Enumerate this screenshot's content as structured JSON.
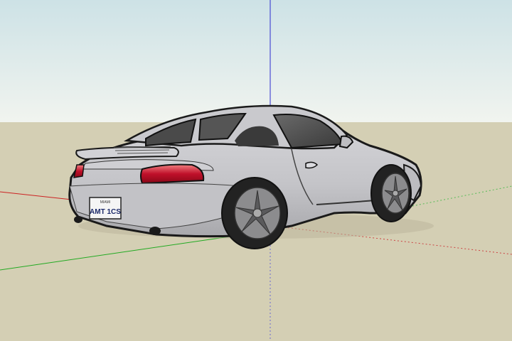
{
  "viewport": {
    "sky_top_color": "#cfe3e6",
    "sky_bottom_color": "#eef3ee",
    "ground_color": "#d4d0b5",
    "axis_red": "#cc2222",
    "axis_green": "#22aa22",
    "axis_blue": "#2222cc"
  },
  "model": {
    "body_color": "#c8c8cc",
    "window_color": "#5a5a5a",
    "taillight_color": "#c0102a",
    "wheel_color": "#2a2a2a",
    "rim_color": "#8a8a8c"
  },
  "license_plate": {
    "top_text": "MIAMI",
    "number": "AMT 1CS"
  }
}
